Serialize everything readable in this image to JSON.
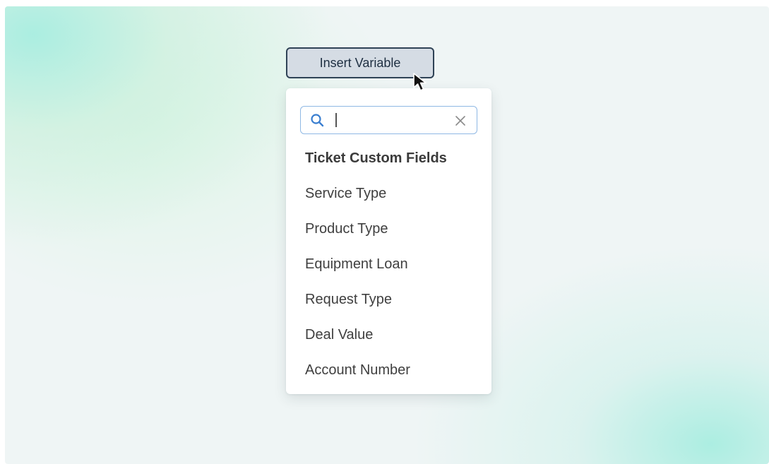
{
  "insert_button": {
    "label": "Insert Variable"
  },
  "dropdown": {
    "search": {
      "value": "",
      "placeholder": "",
      "search_icon": "search-icon",
      "clear_icon": "close-icon"
    },
    "group_header": "Ticket Custom Fields",
    "items": [
      {
        "label": "Service Type"
      },
      {
        "label": "Product Type"
      },
      {
        "label": "Equipment Loan"
      },
      {
        "label": "Request Type"
      },
      {
        "label": "Deal Value"
      },
      {
        "label": "Account Number"
      }
    ]
  },
  "colors": {
    "button_bg": "#d5dce4",
    "button_border": "#2f4256",
    "search_border": "#8fb8e4",
    "search_icon": "#3b7fd0",
    "text": "#3f3f3f",
    "background_accent": "#a0ecde"
  }
}
